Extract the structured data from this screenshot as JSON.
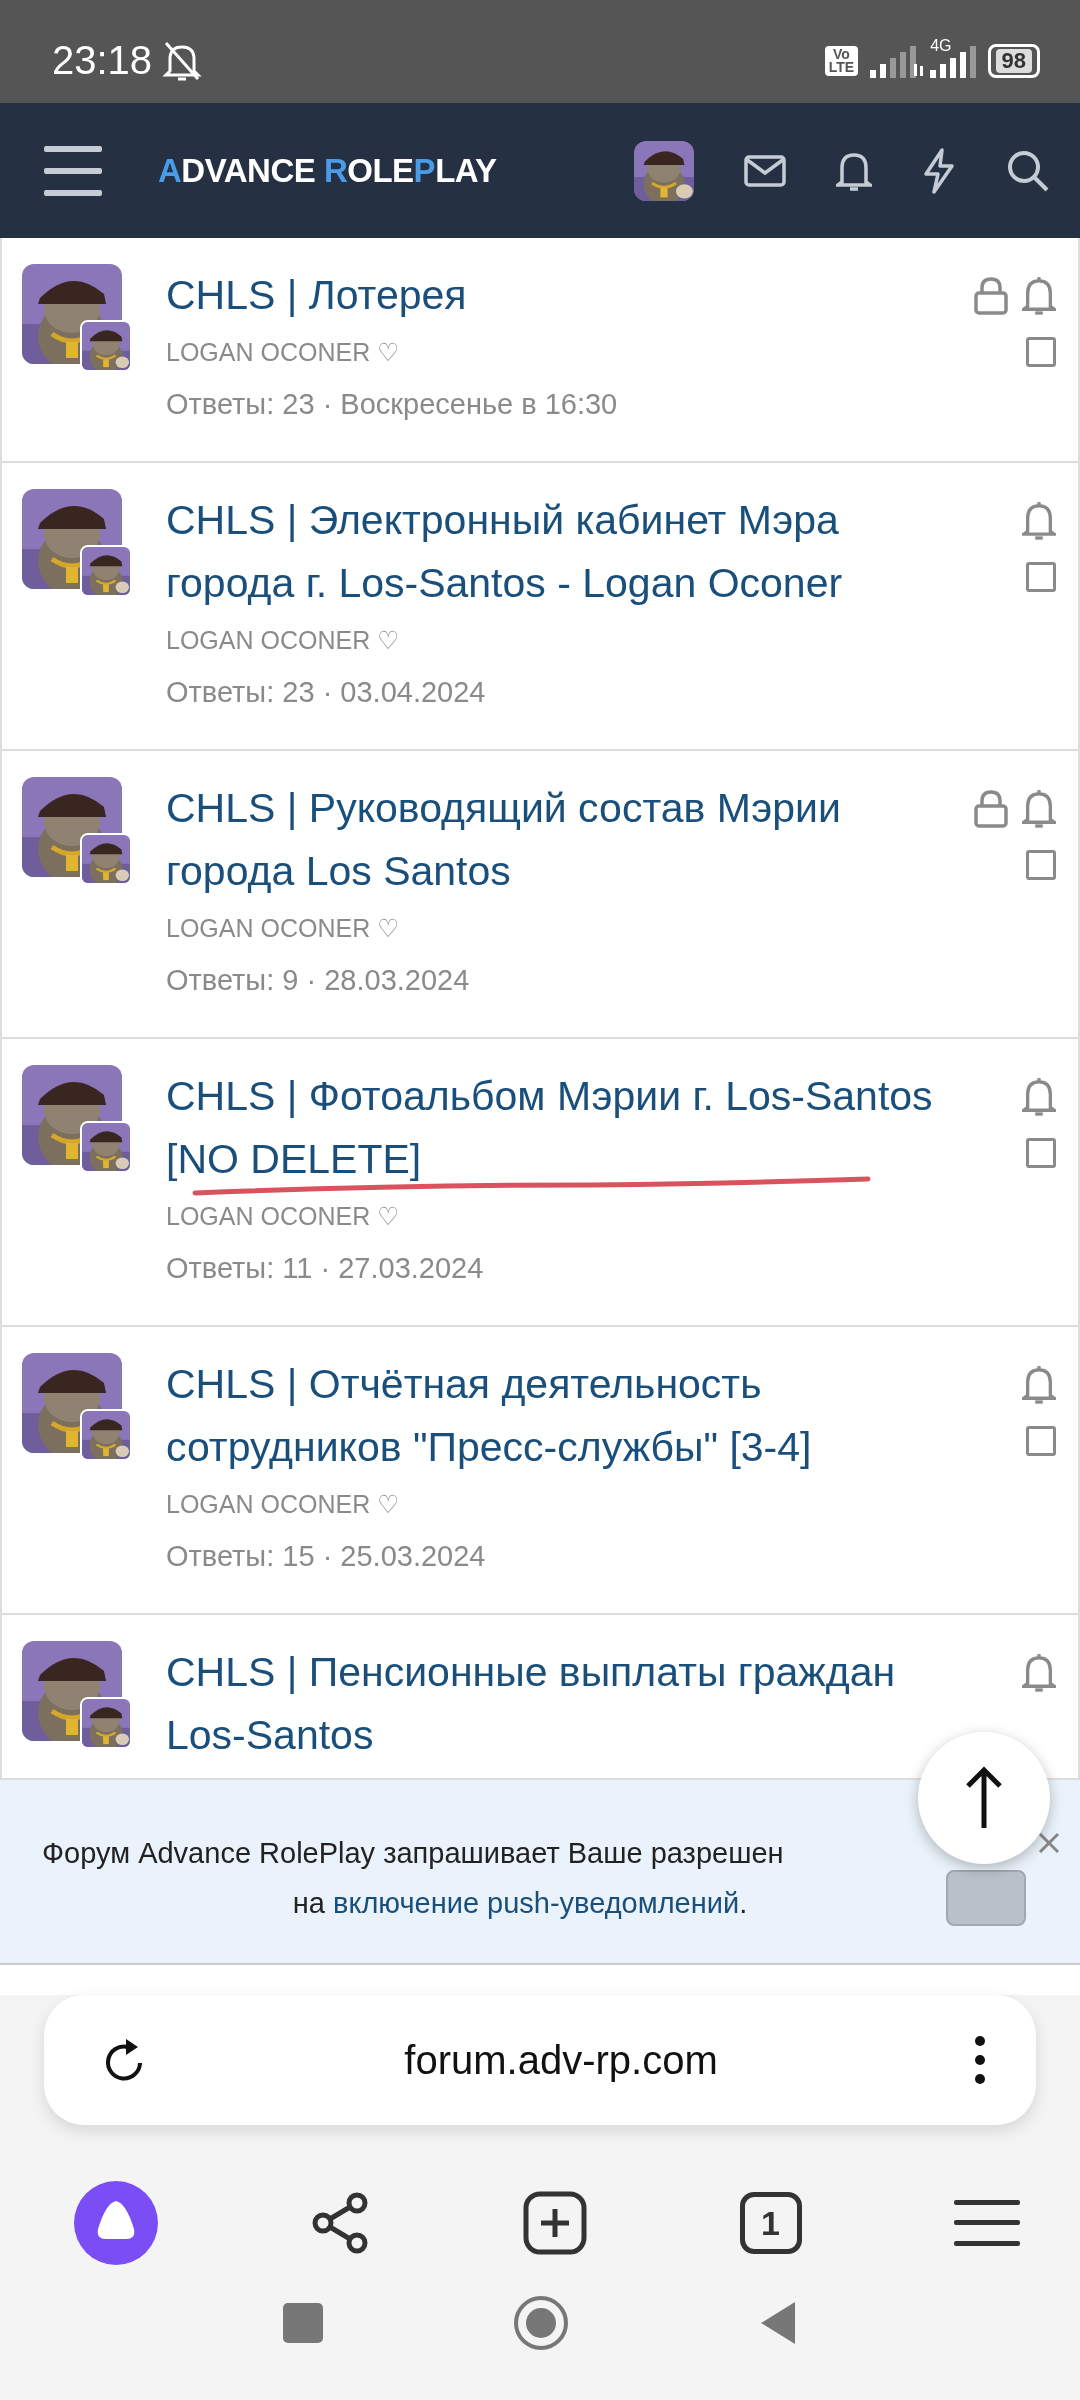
{
  "status_bar": {
    "time": "23:18",
    "volte": [
      "Vo",
      "LTE"
    ],
    "network": "4G",
    "battery": "98"
  },
  "header": {
    "logo": [
      {
        "text": "A",
        "accent": true
      },
      {
        "text": "DVANCE ",
        "accent": false
      },
      {
        "text": "R",
        "accent": true
      },
      {
        "text": "OLE",
        "accent": false
      },
      {
        "text": "P",
        "accent": true
      },
      {
        "text": "LAY",
        "accent": false
      }
    ]
  },
  "threads": [
    {
      "title": "CHLS | Лотерея",
      "author": "LOGAN OCONER ♡",
      "meta": "Ответы: 23 · Воскресенье в 16:30",
      "locked": true,
      "checked": false,
      "underlined": false
    },
    {
      "title": "CHLS | Электронный кабинет Мэра города г. Los-Santos - Logan Oconer",
      "author": "LOGAN OCONER ♡",
      "meta": "Ответы: 23 · 03.04.2024",
      "locked": false,
      "checked": false,
      "underlined": false
    },
    {
      "title": "CHLS | Руководящий состав Мэрии города Los Santos",
      "author": "LOGAN OCONER ♡",
      "meta": "Ответы: 9 · 28.03.2024",
      "locked": true,
      "checked": false,
      "underlined": false
    },
    {
      "title": "CHLS | Фотоальбом Мэрии г. Los-Santos [NO DELETE]",
      "author": "LOGAN OCONER ♡",
      "meta": "Ответы: 11 · 27.03.2024",
      "locked": false,
      "checked": false,
      "underlined": true
    },
    {
      "title": "CHLS | Отчётная деятельность сотрудников \"Пресс-службы\" [3-4]",
      "author": "LOGAN OCONER ♡",
      "meta": "Ответы: 15 · 25.03.2024",
      "locked": false,
      "checked": false,
      "underlined": false
    },
    {
      "title": "CHLS | Пенсионные выплаты граждан Los-Santos",
      "locked": false,
      "underlined": false
    }
  ],
  "push_banner": {
    "line1": "Форум Advance RolePlay запрашивает Ваше разрешен",
    "line2_prefix": "на ",
    "link": "включение push-уведомлений",
    "line2_suffix": "."
  },
  "browser": {
    "url": "forum.adv-rp.com",
    "tab_count": "1"
  }
}
